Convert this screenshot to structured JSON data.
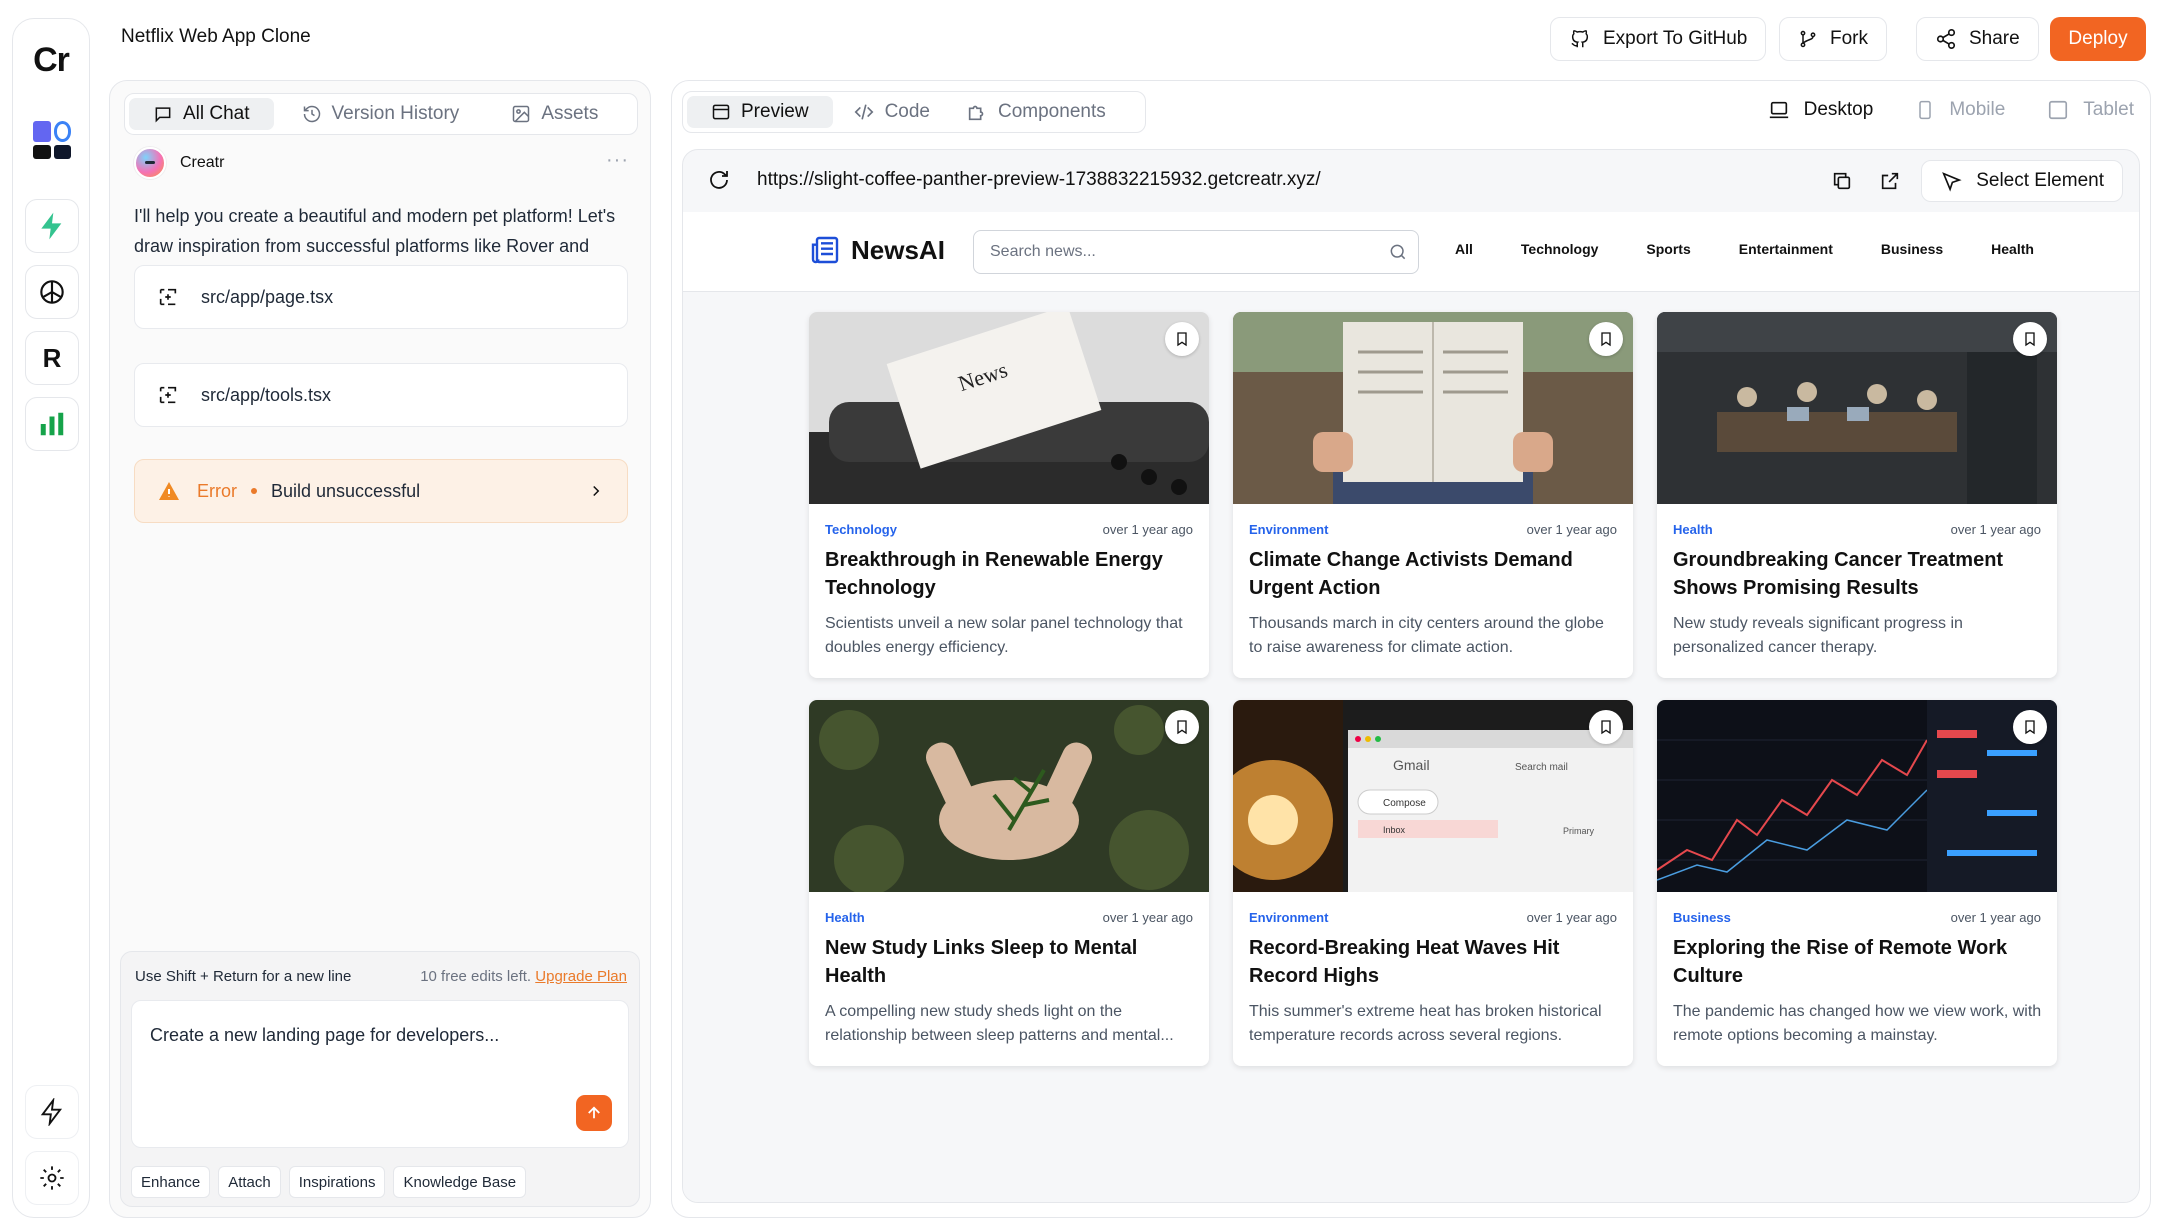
{
  "app": {
    "logo": "Cr",
    "project_title": "Netflix Web App Clone"
  },
  "header": {
    "export_label": "Export To GitHub",
    "fork_label": "Fork",
    "share_label": "Share",
    "deploy_label": "Deploy"
  },
  "chat": {
    "tabs": [
      {
        "label": "All Chat",
        "icon": "chat-icon",
        "active": true
      },
      {
        "label": "Version History",
        "icon": "history-icon",
        "active": false
      },
      {
        "label": "Assets",
        "icon": "image-icon",
        "active": false
      }
    ],
    "sender": "Creatr",
    "message": "I'll help you create a beautiful and modern pet platform! Let's draw inspiration from successful platforms like Rover and Chewy while creating something unique.",
    "files": [
      "src/app/page.tsx",
      "src/app/tools.tsx"
    ],
    "error": {
      "label": "Error",
      "text": "Build unsuccessful"
    },
    "composer": {
      "hint": "Use Shift + Return for a new line",
      "edits_left": "10 free edits left.",
      "upgrade": "Upgrade Plan",
      "placeholder": "Create a new landing page for developers...",
      "chips": [
        "Enhance",
        "Attach",
        "Inspirations",
        "Knowledge Base"
      ]
    }
  },
  "preview": {
    "tabs": [
      {
        "label": "Preview",
        "active": true
      },
      {
        "label": "Code",
        "active": false
      },
      {
        "label": "Components",
        "active": false
      }
    ],
    "devices": [
      {
        "label": "Desktop",
        "active": true
      },
      {
        "label": "Mobile",
        "active": false
      },
      {
        "label": "Tablet",
        "active": false
      }
    ],
    "url": "https://slight-coffee-panther-preview-1738832215932.getcreatr.xyz/",
    "select_element": "Select Element"
  },
  "site": {
    "brand": "NewsAI",
    "search_placeholder": "Search news...",
    "nav": [
      "All",
      "Technology",
      "Sports",
      "Entertainment",
      "Business",
      "Health"
    ],
    "articles": [
      {
        "category": "Technology",
        "time": "over 1 year ago",
        "title": "Breakthrough in Renewable Energy Technology",
        "description": "Scientists unveil a new solar panel technology that doubles energy efficiency."
      },
      {
        "category": "Environment",
        "time": "over 1 year ago",
        "title": "Climate Change Activists Demand Urgent Action",
        "description": "Thousands march in city centers around the globe to raise awareness for climate action."
      },
      {
        "category": "Health",
        "time": "over 1 year ago",
        "title": "Groundbreaking Cancer Treatment Shows Promising Results",
        "description": "New study reveals significant progress in personalized cancer therapy."
      },
      {
        "category": "Health",
        "time": "over 1 year ago",
        "title": "New Study Links Sleep to Mental Health",
        "description": "A compelling new study sheds light on the relationship between sleep patterns and mental..."
      },
      {
        "category": "Environment",
        "time": "over 1 year ago",
        "title": "Record-Breaking Heat Waves Hit Record Highs",
        "description": "This summer's extreme heat has broken historical temperature records across several regions."
      },
      {
        "category": "Business",
        "time": "over 1 year ago",
        "title": "Exploring the Rise of Remote Work Culture",
        "description": "The pandemic has changed how we view work, with remote options becoming a mainstay."
      }
    ],
    "image_texts": {
      "typewriter": "News",
      "gmail": "Gmail",
      "compose": "Compose",
      "inbox": "Inbox",
      "search_mail": "Search mail",
      "primary": "Primary"
    }
  },
  "colors": {
    "accent": "#f26522",
    "category": "#2563eb",
    "error_bg": "#fdf1e6"
  }
}
